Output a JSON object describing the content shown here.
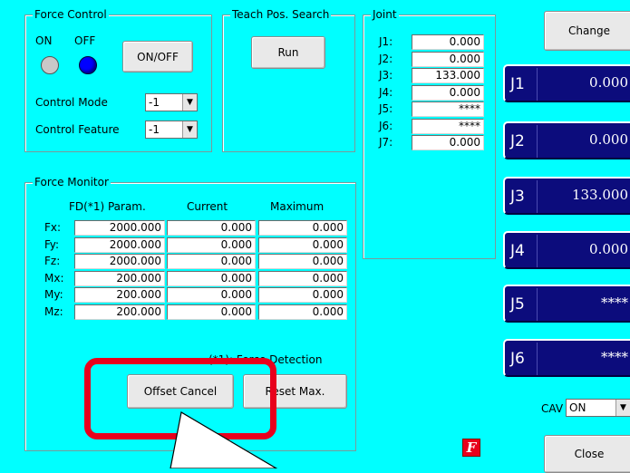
{
  "force_control": {
    "title": "Force Control",
    "on_label": "ON",
    "off_label": "OFF",
    "on_led_color": "#c8c8c8",
    "off_led_color": "#0000ff",
    "onoff_button": "ON/OFF",
    "control_mode_label": "Control Mode",
    "control_mode_value": "-1",
    "control_feature_label": "Control Feature",
    "control_feature_value": "-1"
  },
  "teach_search": {
    "title": "Teach Pos. Search",
    "run_button": "Run"
  },
  "joint": {
    "title": "Joint",
    "rows": [
      {
        "label": "J1:",
        "value": "0.000"
      },
      {
        "label": "J2:",
        "value": "0.000"
      },
      {
        "label": "J3:",
        "value": "133.000"
      },
      {
        "label": "J4:",
        "value": "0.000"
      },
      {
        "label": "J5:",
        "value": "****"
      },
      {
        "label": "J6:",
        "value": "****"
      },
      {
        "label": "J7:",
        "value": "0.000"
      }
    ]
  },
  "right_panel": {
    "change_button": "Change",
    "tiles": [
      {
        "name": "J1",
        "value": "0.000"
      },
      {
        "name": "J2",
        "value": "0.000"
      },
      {
        "name": "J3",
        "value": "133.000"
      },
      {
        "name": "J4",
        "value": "0.000"
      },
      {
        "name": "J5",
        "value": "****"
      },
      {
        "name": "J6",
        "value": "****"
      }
    ],
    "cav_label": "CAV",
    "cav_value": "ON",
    "close_button": "Close"
  },
  "force_monitor": {
    "title": "Force Monitor",
    "col_param": "FD(*1) Param.",
    "col_current": "Current",
    "col_maximum": "Maximum",
    "rows": [
      {
        "label": "Fx:",
        "param": "2000.000",
        "current": "0.000",
        "maximum": "0.000"
      },
      {
        "label": "Fy:",
        "param": "2000.000",
        "current": "0.000",
        "maximum": "0.000"
      },
      {
        "label": "Fz:",
        "param": "2000.000",
        "current": "0.000",
        "maximum": "0.000"
      },
      {
        "label": "Mx:",
        "param": "200.000",
        "current": "0.000",
        "maximum": "0.000"
      },
      {
        "label": "My:",
        "param": "200.000",
        "current": "0.000",
        "maximum": "0.000"
      },
      {
        "label": "Mz:",
        "param": "200.000",
        "current": "0.000",
        "maximum": "0.000"
      }
    ],
    "footnote": "(*1): Force Detection",
    "offset_cancel_button": "Offset Cancel",
    "reset_max_button": "Reset Max."
  },
  "status_icon_letter": "F",
  "highlight_color": "#e8001c"
}
